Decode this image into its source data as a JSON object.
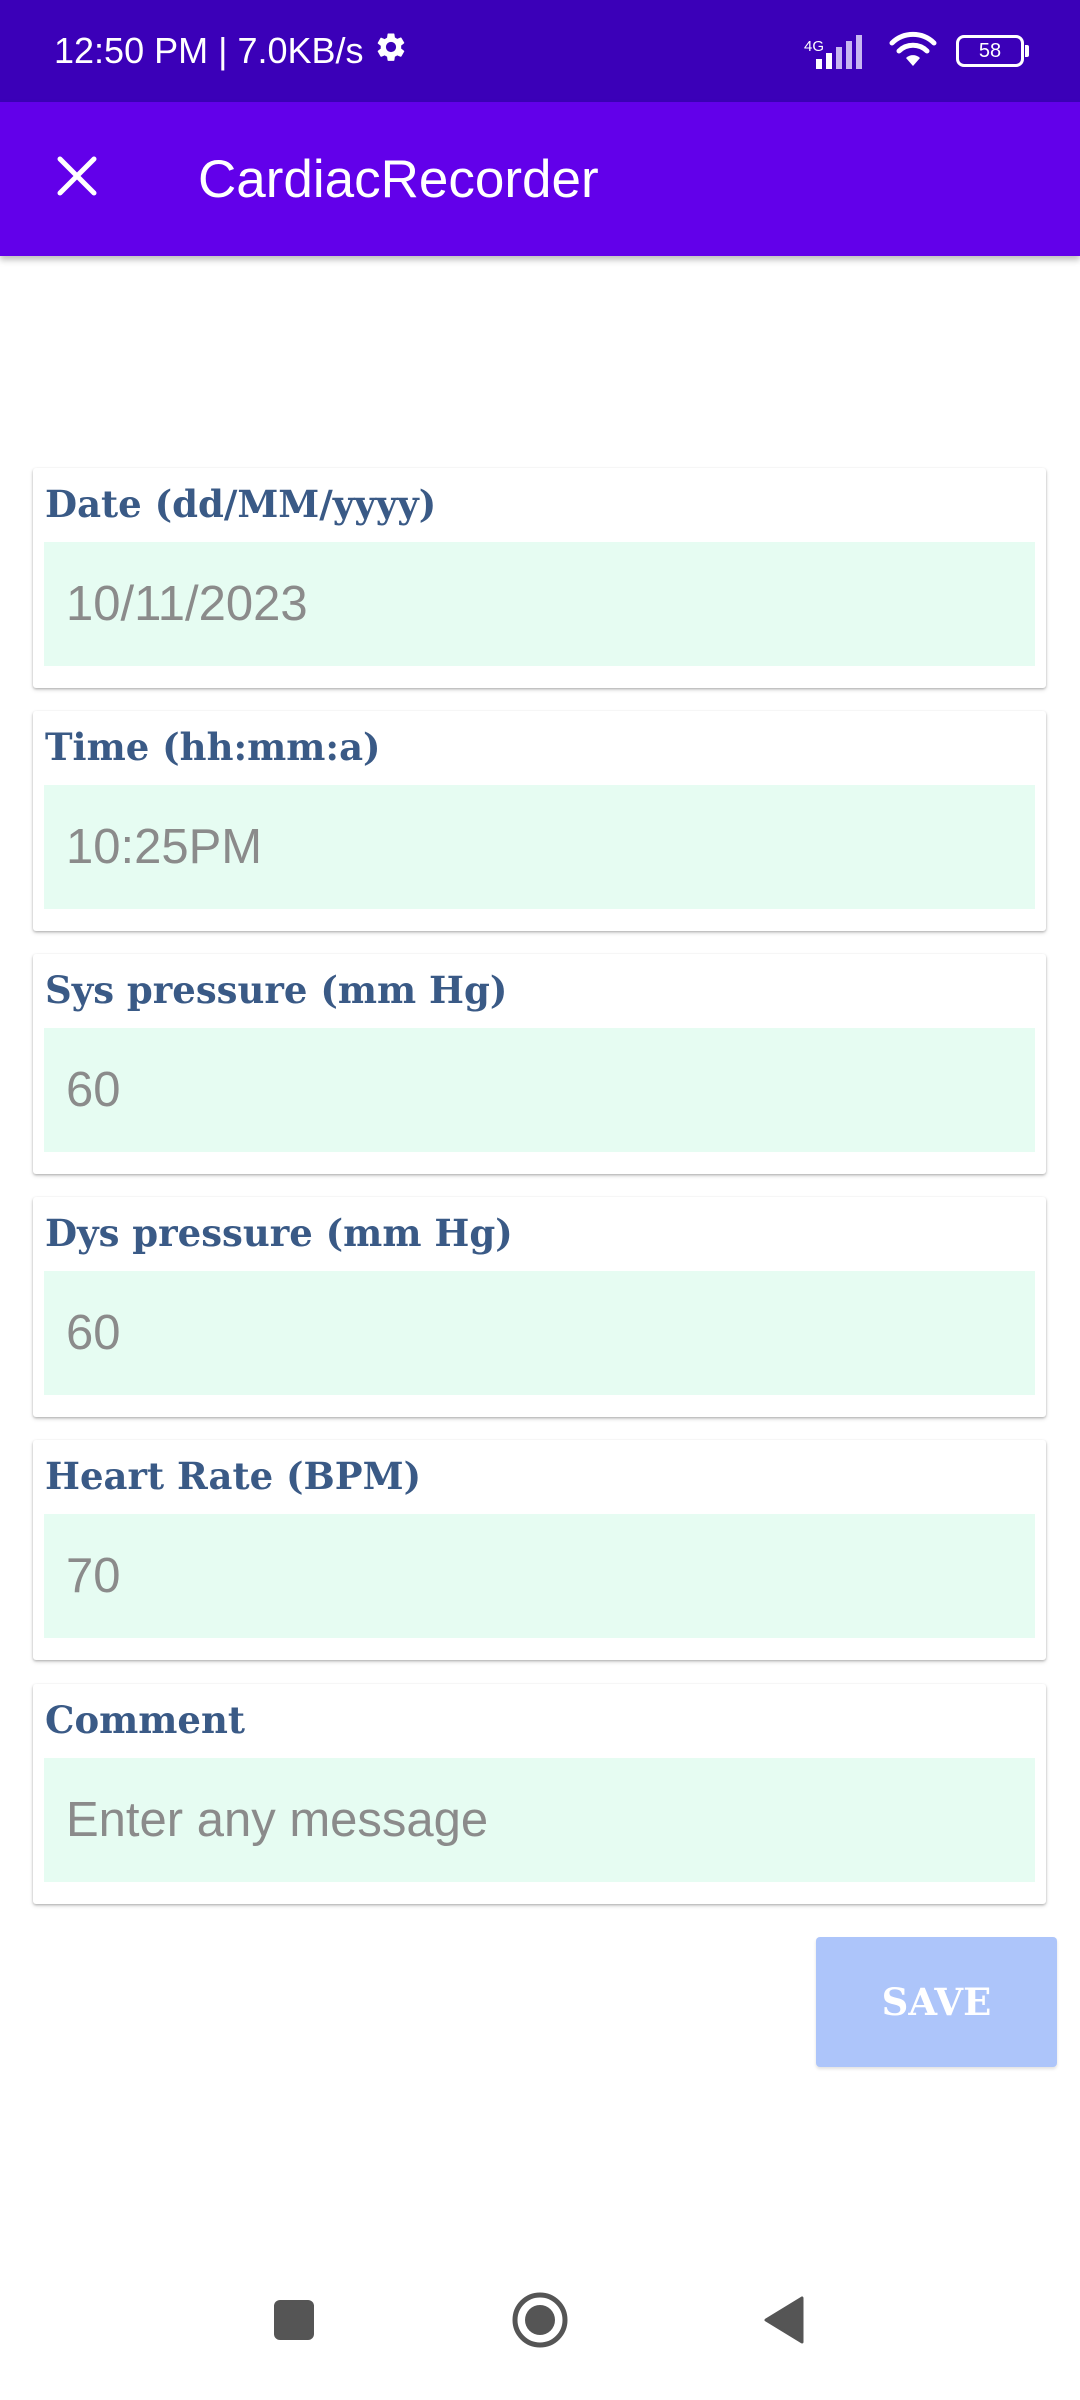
{
  "status_bar": {
    "time_speed": "12:50 PM | 7.0KB/s",
    "network": "4G",
    "battery": "58",
    "icons": [
      "settings-gear-icon",
      "signal-icon",
      "wifi-icon",
      "battery-icon"
    ]
  },
  "app_bar": {
    "title": "CardiacRecorder",
    "close_icon": "close-icon",
    "background": "#6200ea"
  },
  "form": {
    "fields": [
      {
        "label": "Date (dd/MM/yyyy)",
        "value": "10/11/2023"
      },
      {
        "label": "Time (hh:mm:a)",
        "value": "10:25PM"
      },
      {
        "label": "Sys pressure (mm Hg)",
        "value": "60"
      },
      {
        "label": "Dys pressure (mm Hg)",
        "value": "60"
      },
      {
        "label": "Heart Rate (BPM)",
        "value": "70"
      },
      {
        "label": "Comment",
        "value": "",
        "placeholder": "Enter any message"
      }
    ],
    "save_label": "SAVE"
  },
  "nav_bar": {
    "icons": [
      "recents-square-icon",
      "home-circle-icon",
      "back-triangle-icon"
    ]
  },
  "colors": {
    "status_bar": "#3b00b8",
    "field_background": "#e6fcf2",
    "label_text": "#3a5a86",
    "save_button": "#adc5fa"
  }
}
